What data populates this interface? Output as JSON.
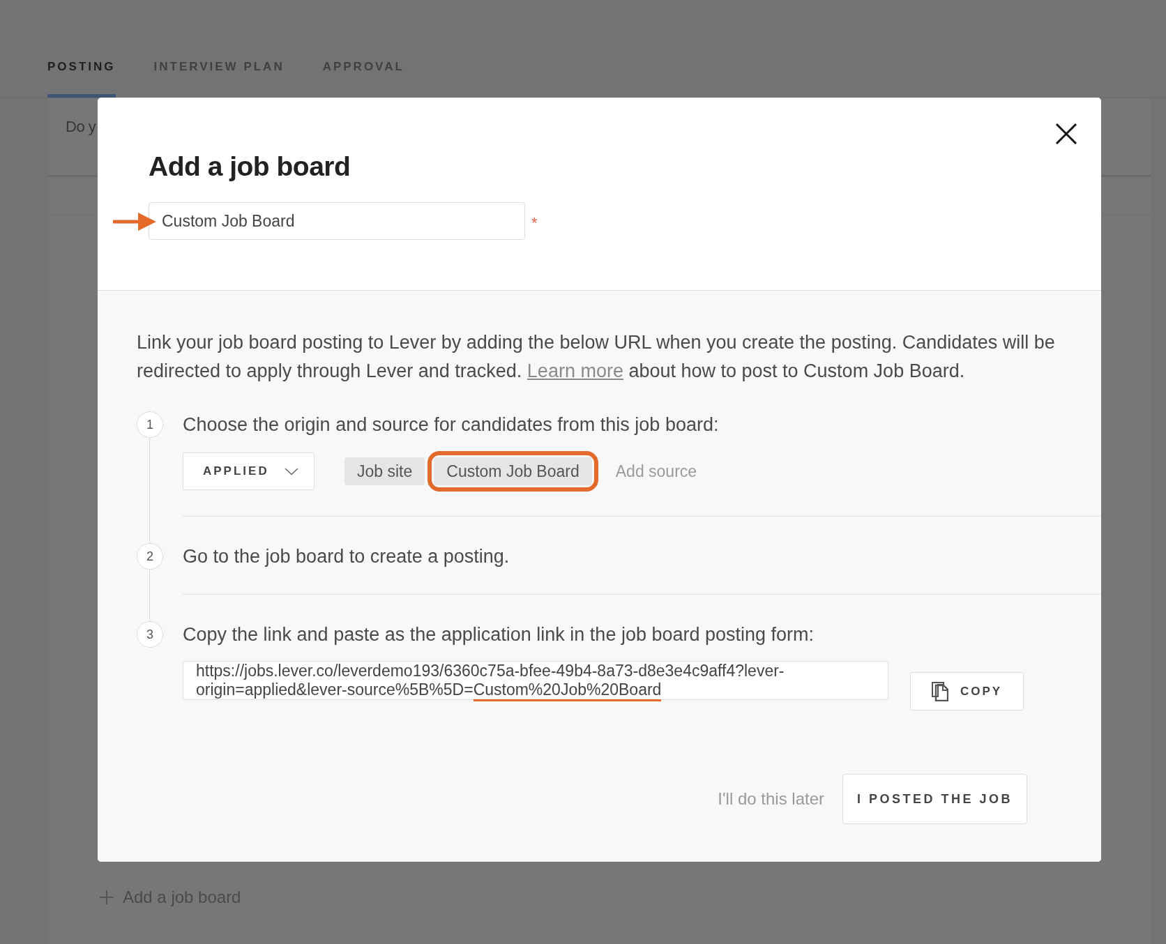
{
  "page": {
    "tabs": [
      {
        "label": "POSTING",
        "selected": true
      },
      {
        "label": "INTERVIEW PLAN",
        "selected": false
      },
      {
        "label": "APPROVAL",
        "selected": false
      }
    ],
    "question_text": "Do y",
    "add_job_board_link": "Add a job board"
  },
  "modal": {
    "title": "Add a job board",
    "name_field": {
      "value": "Custom Job Board",
      "required_mark": "*",
      "annotation_arrow": true
    },
    "intro": {
      "text": "Link your job board posting to Lever by adding the below URL when you create the posting. Candidates will be redirected to apply through Lever and tracked.",
      "link": "Learn more",
      "text_after": "about how to post to Custom Job Board."
    },
    "steps": [
      {
        "kind": "source_picker",
        "number": "1",
        "text": "Choose the origin and source for candidates from this job board:",
        "origin_dropdown": "APPLIED",
        "sources": [
          {
            "label": "Job site",
            "highlighted": false
          },
          {
            "label": "Custom Job Board",
            "highlighted": true
          }
        ],
        "add_source": "Add source"
      },
      {
        "kind": "plain",
        "number": "2",
        "text": "Go to the job board to create a posting."
      },
      {
        "kind": "link_copy",
        "number": "3",
        "text": "Copy the link and paste as the application link in the job board posting form:",
        "url_parts": [
          {
            "text": "https://jobs.lever.co/leverdemo193/6360c75a-bfee-49b4-8a73-d8e3e4c9aff4?lever-origin=applied&lever-source%5B%5D=",
            "underlined": false
          },
          {
            "text": "Custom%20Job%20Board",
            "underlined": true
          }
        ],
        "copy_button": "COPY"
      }
    ],
    "footer": {
      "later_link": "I'll do this later",
      "confirm_button": "I POSTED THE JOB"
    }
  }
}
